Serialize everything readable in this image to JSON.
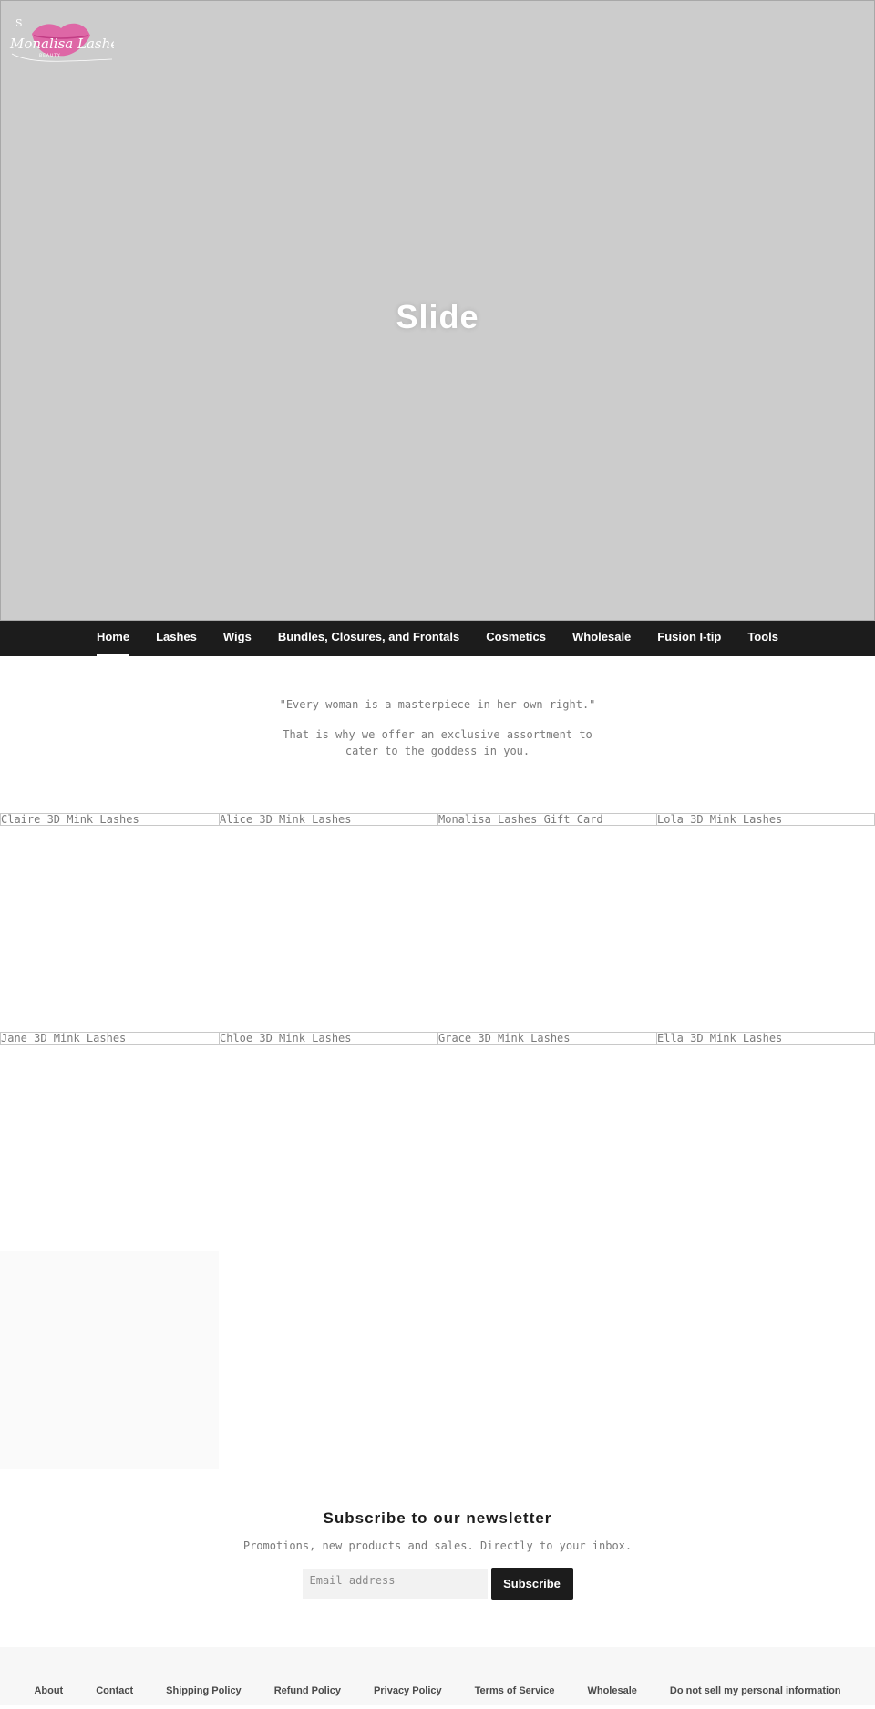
{
  "brand": {
    "logo_alt": "Monalisa Lashes Beauty",
    "logo_script_text": "Monalisa Lashes",
    "logo_sub_text": "BEAUTY",
    "logo_mark": "S",
    "accent_color": "#e0559f"
  },
  "hero": {
    "title": "Slide"
  },
  "nav": {
    "items": [
      {
        "label": "Home",
        "active": true
      },
      {
        "label": "Lashes"
      },
      {
        "label": "Wigs"
      },
      {
        "label": "Bundles, Closures, and Frontals"
      },
      {
        "label": "Cosmetics"
      },
      {
        "label": "Wholesale"
      },
      {
        "label": "Fusion I-tip"
      },
      {
        "label": "Tools"
      }
    ]
  },
  "intro": {
    "quote": "\"Every woman is a masterpiece in her own right.\"",
    "body": "That is why we offer an exclusive assortment to cater to the goddess in you."
  },
  "products": {
    "row1": [
      {
        "title": "Claire 3D Mink Lashes"
      },
      {
        "title": "Alice 3D Mink Lashes"
      },
      {
        "title": "Monalisa Lashes Gift Card"
      },
      {
        "title": "Lola 3D Mink Lashes"
      }
    ],
    "row2": [
      {
        "title": "Jane 3D Mink Lashes"
      },
      {
        "title": "Chloe 3D Mink Lashes"
      },
      {
        "title": "Grace 3D Mink Lashes"
      },
      {
        "title": "Ella 3D Mink Lashes"
      }
    ]
  },
  "newsletter": {
    "title": "Subscribe to our newsletter",
    "subtitle": "Promotions, new products and sales. Directly to your inbox.",
    "email_placeholder": "Email address",
    "email_value": "",
    "button_label": "Subscribe"
  },
  "footer": {
    "links": [
      {
        "label": "About"
      },
      {
        "label": "Contact"
      },
      {
        "label": "Shipping Policy"
      },
      {
        "label": "Refund Policy"
      },
      {
        "label": "Privacy Policy"
      },
      {
        "label": "Terms of Service"
      },
      {
        "label": "Wholesale"
      },
      {
        "label": "Do not sell my personal information"
      }
    ]
  }
}
